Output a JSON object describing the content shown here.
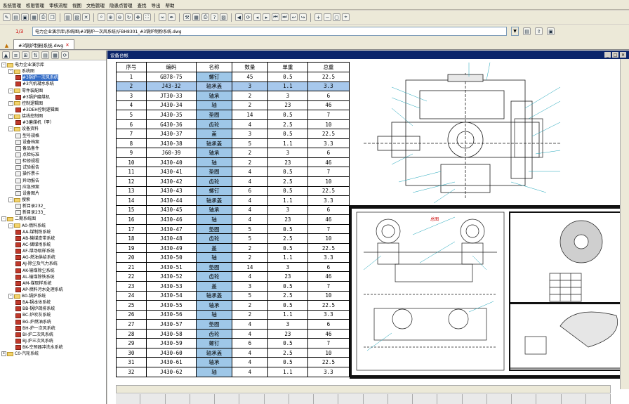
{
  "menu": [
    "系统管理",
    "权限管理",
    "审核流程",
    "视图",
    "文档管理",
    "隐患点管理",
    "查找",
    "导出",
    "帮助"
  ],
  "address": {
    "page": "1/3",
    "path": "电力企业演示库\\系统图\\#3锅炉一次风系统\\\\FBH8301_#3锅炉制粉系统.dwg"
  },
  "doc_tab": "#3锅炉制粉系统.dwg",
  "panel_title": "设备台帐",
  "tree": [
    {
      "level": 0,
      "kind": "root",
      "text": "电力企业演示库",
      "exp": "-"
    },
    {
      "level": 1,
      "kind": "folder",
      "text": "系统图",
      "exp": "-"
    },
    {
      "level": 2,
      "kind": "red",
      "text": "#3锅炉一次风系统",
      "selected": true
    },
    {
      "level": 2,
      "kind": "red",
      "text": "#3汽机凝水系统"
    },
    {
      "level": 1,
      "kind": "folder",
      "text": "零件装配图",
      "exp": "-"
    },
    {
      "level": 2,
      "kind": "red",
      "text": "#3锅炉磨煤机"
    },
    {
      "level": 1,
      "kind": "folder",
      "text": "控制逻辑图",
      "exp": "-"
    },
    {
      "level": 2,
      "kind": "red",
      "text": "#3DEH控制逻辑图"
    },
    {
      "level": 1,
      "kind": "folder",
      "text": "接线控制图",
      "exp": "-"
    },
    {
      "level": 2,
      "kind": "red",
      "text": "#3磨煤机（甲）"
    },
    {
      "level": 1,
      "kind": "folder",
      "text": "设备资料",
      "exp": "-"
    },
    {
      "level": 2,
      "kind": "doc",
      "text": "型号规格"
    },
    {
      "level": 2,
      "kind": "doc",
      "text": "设备档案"
    },
    {
      "level": 2,
      "kind": "doc",
      "text": "备品备件"
    },
    {
      "level": 2,
      "kind": "doc",
      "text": "点检标准"
    },
    {
      "level": 2,
      "kind": "doc",
      "text": "检修规程"
    },
    {
      "level": 2,
      "kind": "doc",
      "text": "试验报告"
    },
    {
      "level": 2,
      "kind": "doc",
      "text": "操作票卡"
    },
    {
      "level": 2,
      "kind": "doc",
      "text": "异动报告"
    },
    {
      "level": 2,
      "kind": "doc",
      "text": "应急预案"
    },
    {
      "level": 2,
      "kind": "doc",
      "text": "设备图片"
    },
    {
      "level": 1,
      "kind": "folder",
      "text": "搜索",
      "exp": "-"
    },
    {
      "level": 2,
      "kind": "doc",
      "text": "新目录232_"
    },
    {
      "level": 2,
      "kind": "doc",
      "text": "新目录233_"
    },
    {
      "level": 0,
      "kind": "root",
      "text": "二期系统图",
      "exp": "-"
    },
    {
      "level": 1,
      "kind": "folder",
      "text": "A0-燃料系统",
      "exp": "-"
    },
    {
      "level": 2,
      "kind": "red",
      "text": "AA-煤制粉系统"
    },
    {
      "level": 2,
      "kind": "red",
      "text": "AB-输煤皮带系统"
    },
    {
      "level": 2,
      "kind": "red",
      "text": "AC-储煤场系统"
    },
    {
      "level": 2,
      "kind": "red",
      "text": "AF-煤场取样系统"
    },
    {
      "level": 2,
      "kind": "red",
      "text": "AG-燃油供给系统"
    },
    {
      "level": 2,
      "kind": "red",
      "text": "AJ-除尘及气力系统"
    },
    {
      "level": 2,
      "kind": "red",
      "text": "AK-输煤除尘系统"
    },
    {
      "level": 2,
      "kind": "red",
      "text": "AL-输煤除铁系统"
    },
    {
      "level": 2,
      "kind": "red",
      "text": "AM-煤取样系统"
    },
    {
      "level": 2,
      "kind": "red",
      "text": "AP-燃料污水处理系统"
    },
    {
      "level": 1,
      "kind": "folder",
      "text": "B0-锅炉系统",
      "exp": "-"
    },
    {
      "level": 2,
      "kind": "red",
      "text": "BA-锅本体系统"
    },
    {
      "level": 2,
      "kind": "red",
      "text": "BB-锅炉疏排系统"
    },
    {
      "level": 2,
      "kind": "red",
      "text": "BC-炉吹灰系统"
    },
    {
      "level": 2,
      "kind": "red",
      "text": "BG-炉燃油系统"
    },
    {
      "level": 2,
      "kind": "red",
      "text": "BH-炉一次风系统"
    },
    {
      "level": 2,
      "kind": "red",
      "text": "BI-炉二次风系统"
    },
    {
      "level": 2,
      "kind": "red",
      "text": "BJ-炉三次风系统"
    },
    {
      "level": 2,
      "kind": "red",
      "text": "BK-空预器冲洗水系统"
    },
    {
      "level": 0,
      "kind": "root",
      "text": "C0-汽轮系统",
      "exp": "+"
    }
  ],
  "table": {
    "headers": [
      "序号",
      "编码",
      "名称",
      "数量",
      "单重",
      "总重"
    ],
    "rows": [
      [
        "1",
        "GB78-75",
        "螺钉",
        "45",
        "0.5",
        "22.5"
      ],
      [
        "2",
        "J43-32",
        "轴承盖",
        "3",
        "1.1",
        "3.3"
      ],
      [
        "3",
        "JT30-33",
        "轴承",
        "2",
        "3",
        "6"
      ],
      [
        "4",
        "J430-34",
        "轴",
        "2",
        "23",
        "46"
      ],
      [
        "5",
        "J430-35",
        "垫圈",
        "14",
        "0.5",
        "7"
      ],
      [
        "6",
        "G430-36",
        "齿轮",
        "4",
        "2.5",
        "10"
      ],
      [
        "7",
        "J430-37",
        "盖",
        "3",
        "0.5",
        "22.5"
      ],
      [
        "8",
        "J430-38",
        "轴承盖",
        "5",
        "1.1",
        "3.3"
      ],
      [
        "9",
        "J60-39",
        "轴承",
        "2",
        "3",
        "6"
      ],
      [
        "10",
        "J430-40",
        "轴",
        "2",
        "23",
        "46"
      ],
      [
        "11",
        "J430-41",
        "垫圈",
        "4",
        "0.5",
        "7"
      ],
      [
        "12",
        "J430-42",
        "齿轮",
        "4",
        "2.5",
        "10"
      ],
      [
        "13",
        "J430-43",
        "螺钉",
        "6",
        "0.5",
        "22.5"
      ],
      [
        "14",
        "J430-44",
        "轴承盖",
        "4",
        "1.1",
        "3.3"
      ],
      [
        "15",
        "J430-45",
        "轴承",
        "4",
        "3",
        "6"
      ],
      [
        "16",
        "J430-46",
        "轴",
        "4",
        "23",
        "46"
      ],
      [
        "17",
        "J430-47",
        "垫圈",
        "5",
        "0.5",
        "7"
      ],
      [
        "18",
        "J430-48",
        "齿轮",
        "5",
        "2.5",
        "10"
      ],
      [
        "19",
        "J430-49",
        "盖",
        "2",
        "0.5",
        "22.5"
      ],
      [
        "20",
        "J430-50",
        "轴",
        "2",
        "1.1",
        "3.3"
      ],
      [
        "21",
        "J430-51",
        "垫圈",
        "14",
        "3",
        "6"
      ],
      [
        "22",
        "J430-52",
        "齿轮",
        "4",
        "23",
        "46"
      ],
      [
        "23",
        "J430-53",
        "盖",
        "3",
        "0.5",
        "7"
      ],
      [
        "24",
        "J430-54",
        "轴承盖",
        "5",
        "2.5",
        "10"
      ],
      [
        "25",
        "J430-55",
        "轴承",
        "2",
        "0.5",
        "22.5"
      ],
      [
        "26",
        "J430-56",
        "轴",
        "2",
        "1.1",
        "3.3"
      ],
      [
        "27",
        "J430-57",
        "垫圈",
        "4",
        "3",
        "6"
      ],
      [
        "28",
        "J430-58",
        "齿轮",
        "4",
        "23",
        "46"
      ],
      [
        "29",
        "J430-59",
        "螺钉",
        "6",
        "0.5",
        "7"
      ],
      [
        "30",
        "J430-60",
        "轴承盖",
        "4",
        "2.5",
        "10"
      ],
      [
        "31",
        "J430-61",
        "轴承",
        "4",
        "0.5",
        "22.5"
      ],
      [
        "32",
        "J430-62",
        "轴",
        "4",
        "1.1",
        "3.3"
      ]
    ]
  },
  "drawing_label": "总图"
}
